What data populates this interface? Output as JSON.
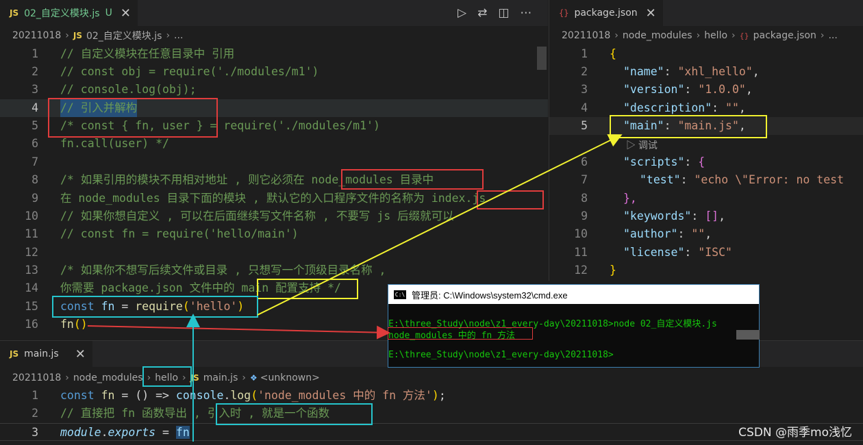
{
  "left_editor": {
    "tab_icon": "JS",
    "tab_title": "02_自定义模块.js",
    "tab_status": "U",
    "close_glyph": "✕",
    "breadcrumb": [
      "20211018",
      "02_自定义模块.js",
      "..."
    ],
    "lines": [
      {
        "n": "1",
        "text": "// 自定义模块在任意目录中 引用"
      },
      {
        "n": "2",
        "text": "// const obj = require('./modules/m1')"
      },
      {
        "n": "3",
        "text": "// console.log(obj);"
      },
      {
        "n": "4",
        "text": "// 引入并解构"
      },
      {
        "n": "5",
        "p1": "/* const ",
        "p2": "{",
        "p3": " fn, user ",
        "p4": "}",
        "p5": " = require(",
        "p6": "'./modules/m1'",
        "p7": ")"
      },
      {
        "n": "6",
        "p1": "fn.call(",
        "p2": "user",
        "p3": ") */"
      },
      {
        "n": "7",
        "text": ""
      },
      {
        "n": "8",
        "text": "/* 如果引用的模块不用相对地址 , 则它必须在 node_modules 目录中"
      },
      {
        "n": "9",
        "text": "在 node_modules 目录下面的模块 , 默认它的入口程序文件的名称为 index.js"
      },
      {
        "n": "10",
        "text": "// 如果你想自定义 , 可以在后面继续写文件名称 , 不要写 js 后缀就可以"
      },
      {
        "n": "11",
        "p1": "// const fn = require(",
        "p2": "'hello/main'",
        "p3": ")"
      },
      {
        "n": "12",
        "text": ""
      },
      {
        "n": "13",
        "text": "/* 如果你不想写后续文件或目录 , 只想写一个顶级目录名称 ,"
      },
      {
        "n": "14",
        "text": "你需要 package.json 文件中的 main 配置支持 */"
      },
      {
        "n": "15",
        "kw": "const",
        "var": "fn",
        "eq": "=",
        "fn": "require",
        "open": "(",
        "str": "'hello'",
        "close": ")"
      },
      {
        "n": "16",
        "fn": "fn",
        "parens": "()"
      }
    ]
  },
  "right_editor": {
    "tab_icon": "{}",
    "tab_title": "package.json",
    "close_glyph": "✕",
    "breadcrumb": [
      "20211018",
      "node_modules",
      "hello",
      "package.json",
      "..."
    ],
    "codelens": "▷ 调试",
    "lines": [
      {
        "n": "1",
        "punct": "{"
      },
      {
        "n": "2",
        "key": "\"name\"",
        "val": "\"xhl_hello\"",
        "tail": ","
      },
      {
        "n": "3",
        "key": "\"version\"",
        "val": "\"1.0.0\"",
        "tail": ","
      },
      {
        "n": "4",
        "key": "\"description\"",
        "val": "\"\"",
        "tail": ","
      },
      {
        "n": "5",
        "key": "\"main\"",
        "val": "\"main.js\"",
        "tail": ","
      },
      {
        "n": "6",
        "key": "\"scripts\"",
        "open": "{"
      },
      {
        "n": "7",
        "key": "\"test\"",
        "val": "\"echo \\\"Error: no test"
      },
      {
        "n": "8",
        "punct": "},"
      },
      {
        "n": "9",
        "key": "\"keywords\"",
        "arr": "[]",
        "tail": ","
      },
      {
        "n": "10",
        "key": "\"author\"",
        "val": "\"\"",
        "tail": ","
      },
      {
        "n": "11",
        "key": "\"license\"",
        "val": "\"ISC\""
      },
      {
        "n": "12",
        "punct": "}"
      }
    ]
  },
  "bottom_editor": {
    "tab_icon": "JS",
    "tab_title": "main.js",
    "close_glyph": "✕",
    "breadcrumb": [
      "20211018",
      "node_modules",
      "hello",
      "main.js",
      "<unknown>"
    ],
    "lines": [
      {
        "n": "1",
        "kw": "const",
        "var": "fn",
        "p1": " = () => ",
        "obj": "console",
        "dot": ".",
        "fn": "log",
        "open": "(",
        "str": "'node_modules 中的 fn 方法'",
        "close": ")",
        "tail": ";"
      },
      {
        "n": "2",
        "text": "// 直接把 fn 函数导出 , 引入时 , 就是一个函数"
      },
      {
        "n": "3",
        "it1": "module",
        "dot": ".",
        "it2": "exports",
        "eq": " = ",
        "var": "fn"
      }
    ]
  },
  "cmd": {
    "title": "管理员: C:\\Windows\\system32\\cmd.exe",
    "icon_label": "C:\\",
    "lines": [
      "E:\\three_Study\\node\\z1_every-day\\20211018>node 02_自定义模块.js",
      "node_modules 中的 fn 方法",
      "",
      "E:\\three_Study\\node\\z1_every-day\\20211018>"
    ]
  },
  "watermark": "CSDN @雨季mo浅忆",
  "annotation_colors": {
    "red": "#e03c3c",
    "yellow": "#f2f230",
    "cyan": "#26c4cc"
  }
}
